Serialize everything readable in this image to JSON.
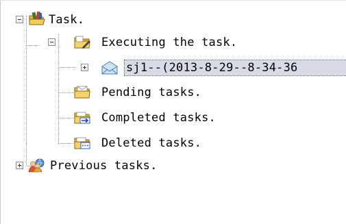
{
  "tree": {
    "root": {
      "label": "Task.",
      "icon": "folder-books-icon",
      "expanded": true
    },
    "executing": {
      "label": "Executing the task.",
      "icon": "folder-edit-icon",
      "expanded": true
    },
    "task_item": {
      "label": "sj1--(2013-8-29--8-34-36",
      "icon": "envelope-icon",
      "expanded": false,
      "selected": true
    },
    "pending": {
      "label": "Pending tasks.",
      "icon": "folder-envelope-icon"
    },
    "completed": {
      "label": "Completed tasks.",
      "icon": "folder-arrow-icon"
    },
    "deleted": {
      "label": "Deleted tasks.",
      "icon": "folder-dashed-icon"
    },
    "previous": {
      "label": "Previous tasks.",
      "icon": "users-globe-icon",
      "expanded": false
    }
  }
}
